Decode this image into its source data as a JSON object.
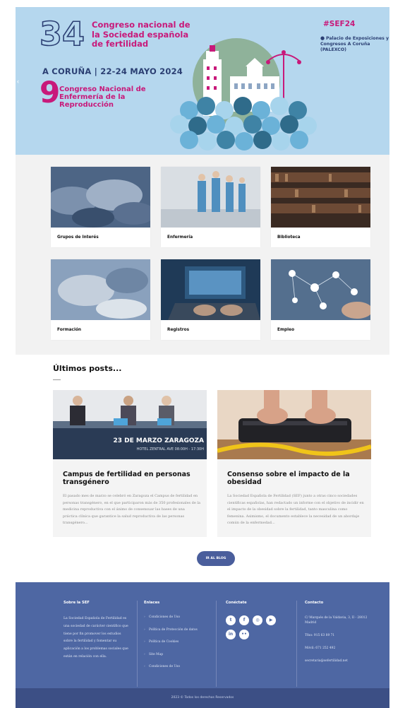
{
  "hero": {
    "number": "34",
    "congress_title": "Congreso nacional de la Sociedad española de fertilidad",
    "location_dates": "A CORUÑA | 22-24 MAYO 2024",
    "second_number": "9",
    "second_title": "Congreso Nacional de Enfermería de la Reproducción",
    "hashtag": "#SEF24",
    "venue": "Palacio de Exposiciones y Congresos A Coruña (PALEXCO)",
    "prev_arrow": "‹"
  },
  "grid": {
    "items": [
      {
        "label": "Grupos de Interés"
      },
      {
        "label": "Enfermería"
      },
      {
        "label": "Biblioteca"
      },
      {
        "label": "Formación"
      },
      {
        "label": "Registros"
      },
      {
        "label": "Empleo"
      }
    ]
  },
  "posts": {
    "section_title": "Últimos posts...",
    "items": [
      {
        "image_banner_1": "23 DE MARZO ZARAGOZA",
        "image_banner_2": "HOTEL ZENTRAL AVE   08:00H - 17:30H",
        "title": "Campus de fertilidad en personas transgénero",
        "excerpt": "El pasado mes de marzo se celebró en Zaragoza el Campus de fertilidad en personas transgénero, en el que participaron más de 350 profesionales de la medicina reproductiva con el ánimo de consensuar las bases de una práctica clínica que garantice la salud reproductiva de las personas transgénero..."
      },
      {
        "title": "Consenso sobre el impacto de la obesidad",
        "excerpt": "La Sociedad Española de Fertilidad (SEF) junto a otras cinco sociedades científicas españolas, han redactado un informe con el objetivo de incidir en el impacto de la obesidad sobre la fertilidad, tanto masculina como femenina. Asimismo, el documento establece la necesidad de un abordaje común de la enfermedad..."
      }
    ],
    "blog_button": "IR AL BLOG"
  },
  "footer": {
    "about": {
      "heading": "Sobre la SEF",
      "text": "La Sociedad Española de Fertilidad es una sociedad de carácter científico que tiene por fin promover los estudios sobre la fertilidad y fomentar su aplicación a los problemas sociales que están en relación con ella."
    },
    "links": {
      "heading": "Enlaces",
      "items": [
        "Condiciones de Uso",
        "Política de Protección de datos",
        "Política de Cookies",
        "Site Map",
        "Condiciones de Uso"
      ]
    },
    "social": {
      "heading": "Conéctate",
      "icons": [
        "twitter-icon",
        "facebook-icon",
        "instagram-icon",
        "youtube-icon",
        "linkedin-icon",
        "flickr-icon"
      ]
    },
    "contact": {
      "heading": "Contacto",
      "address": "C/ Marqués de la Valdavia, 3, II - 28012 Madrid",
      "phone": "Tfno: 915 63 89 71",
      "mobile": "Móvil: 671 252 492",
      "email": "secretaria@sefertilidad.net"
    },
    "copyright": "2023 © Todos los derechos Reservados"
  },
  "colors": {
    "hero_bg": "#b5d7ee",
    "magenta": "#c8197a",
    "navy": "#2b3f73",
    "footer_bg": "#4e67a3",
    "footer_bottom": "#3c4f85",
    "button": "#4a5e9c"
  }
}
